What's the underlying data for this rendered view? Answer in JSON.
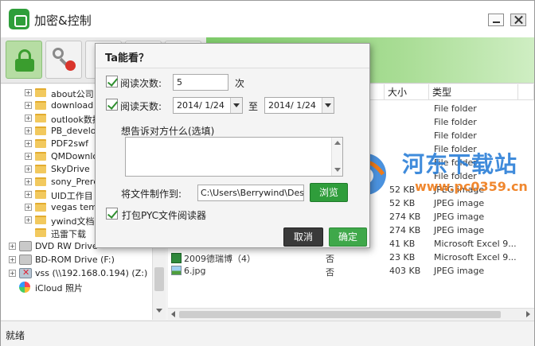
{
  "window": {
    "title": "加密&控制"
  },
  "toolbar": {
    "buttons": [
      {
        "icon": "lock-icon"
      },
      {
        "icon": "key-forbidden-icon"
      }
    ],
    "accent": "#3a9d2e"
  },
  "tree": {
    "items": [
      {
        "label": "about公司",
        "type": "folder"
      },
      {
        "label": "download",
        "type": "folder"
      },
      {
        "label": "outlook数据",
        "type": "folder"
      },
      {
        "label": "PB_develop",
        "type": "folder"
      },
      {
        "label": "PDF2swf",
        "type": "folder"
      },
      {
        "label": "QMDownload",
        "type": "folder"
      },
      {
        "label": "SkyDrive",
        "type": "folder"
      },
      {
        "label": "sony_Prere",
        "type": "folder"
      },
      {
        "label": "UID工作目",
        "type": "folder"
      },
      {
        "label": "vegas temp",
        "type": "folder"
      },
      {
        "label": "ywind文档",
        "type": "folder"
      },
      {
        "label": "迅雷下载",
        "type": "folder"
      },
      {
        "label": "DVD RW Drive",
        "type": "drive"
      },
      {
        "label": "BD-ROM Drive (F:)",
        "type": "drive"
      },
      {
        "label": "vss (\\\\192.168.0.194) (Z:)",
        "type": "net"
      },
      {
        "label": "iCloud 照片",
        "type": "icloud"
      }
    ]
  },
  "filelist": {
    "columns": {
      "size": "大小",
      "type": "类型"
    },
    "rows": [
      {
        "name": "",
        "flag": "",
        "size": "",
        "type": "File folder"
      },
      {
        "name": "",
        "flag": "",
        "size": "",
        "type": "File folder"
      },
      {
        "name": "",
        "flag": "",
        "size": "",
        "type": "File folder"
      },
      {
        "name": "",
        "flag": "",
        "size": "",
        "type": "File folder"
      },
      {
        "name": "",
        "flag": "",
        "size": "",
        "type": "File folder"
      },
      {
        "name": "",
        "flag": "",
        "size": "",
        "type": "File folder"
      },
      {
        "name": "",
        "flag": "",
        "size": "52 KB",
        "type": "JPEG image"
      },
      {
        "name": "",
        "flag": "",
        "size": "52 KB",
        "type": "JPEG image"
      },
      {
        "name": "",
        "flag": "",
        "size": "274 KB",
        "type": "JPEG image"
      },
      {
        "name": "",
        "flag": "",
        "size": "274 KB",
        "type": "JPEG image"
      },
      {
        "name": "",
        "flag": "",
        "size": "41 KB",
        "type": "Microsoft Excel 9..."
      },
      {
        "name": "2009德瑞博（4）",
        "flag": "否",
        "size": "23 KB",
        "type": "Microsoft Excel 9..."
      },
      {
        "name": "6.jpg",
        "flag": "否",
        "size": "403 KB",
        "type": "JPEG image"
      }
    ]
  },
  "watermark": {
    "title": "河东下载站",
    "url": "www.pc0359.cn"
  },
  "status": {
    "text": "就绪"
  },
  "dialog": {
    "title": "Ta能看？",
    "read_count_label": "阅读次数:",
    "read_count_value": "5",
    "read_count_unit": "次",
    "read_days_label": "阅读天数:",
    "date_from": "2014/ 1/24",
    "date_to_label": "至",
    "date_to": "2014/ 1/24",
    "message_label": "想告诉对方什么(选填)",
    "message_value": "",
    "save_to_label": "将文件制作到:",
    "save_path": "C:\\Users\\Berrywind\\Desktop",
    "browse_label": "浏览",
    "pack_label": "打包PYC文件阅读器",
    "cancel_label": "取消",
    "ok_label": "确定",
    "colors": {
      "ok": "#3fa84a",
      "cancel": "#3a3a3a",
      "browse": "#2f9d3b"
    }
  }
}
